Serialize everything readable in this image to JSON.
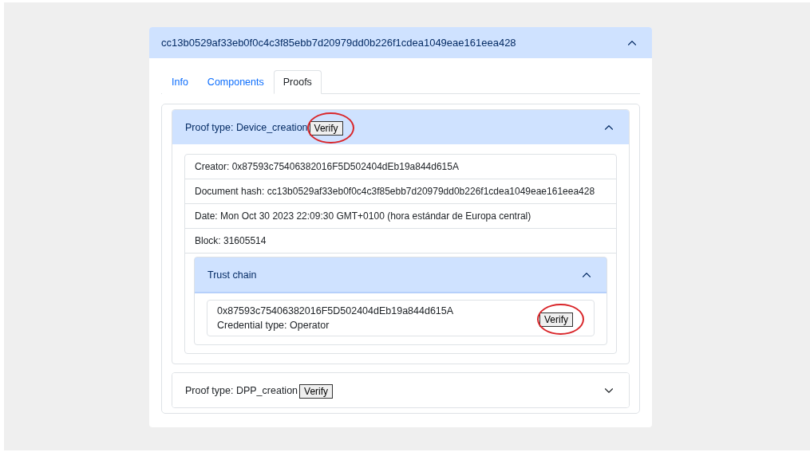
{
  "accordion": {
    "title": "cc13b0529af33eb0f0c4c3f85ebb7d20979dd0b226f1cdea1049eae161eea428",
    "expanded": true,
    "tabs": [
      {
        "label": "Info",
        "selected": false
      },
      {
        "label": "Components",
        "selected": false
      },
      {
        "label": "Proofs",
        "selected": true
      }
    ],
    "proofs": [
      {
        "title": "Proof type: Device_creation",
        "verify": {
          "label": "Verify",
          "circled": true
        },
        "expanded": true,
        "fields": [
          "Creator: 0x87593c75406382016F5D502404dEb19a844d615A",
          "Document hash: cc13b0529af33eb0f0c4c3f85ebb7d20979dd0b226f1cdea1049eae161eea428",
          "Date: Mon Oct 30 2023 22:09:30 GMT+0100 (hora estándar de Europa central)",
          "Block: 31605514"
        ],
        "trust_chain": {
          "title": "Trust chain",
          "expanded": true,
          "entries": [
            {
              "address": "0x87593c75406382016F5D502404dEb19a844d615A",
              "credential": "Credential type: Operator",
              "verify": {
                "label": "Verify",
                "circled": true
              }
            }
          ]
        }
      },
      {
        "title": "Proof type: DPP_creation",
        "verify": {
          "label": "Verify",
          "circled": false
        },
        "expanded": false
      }
    ]
  }
}
